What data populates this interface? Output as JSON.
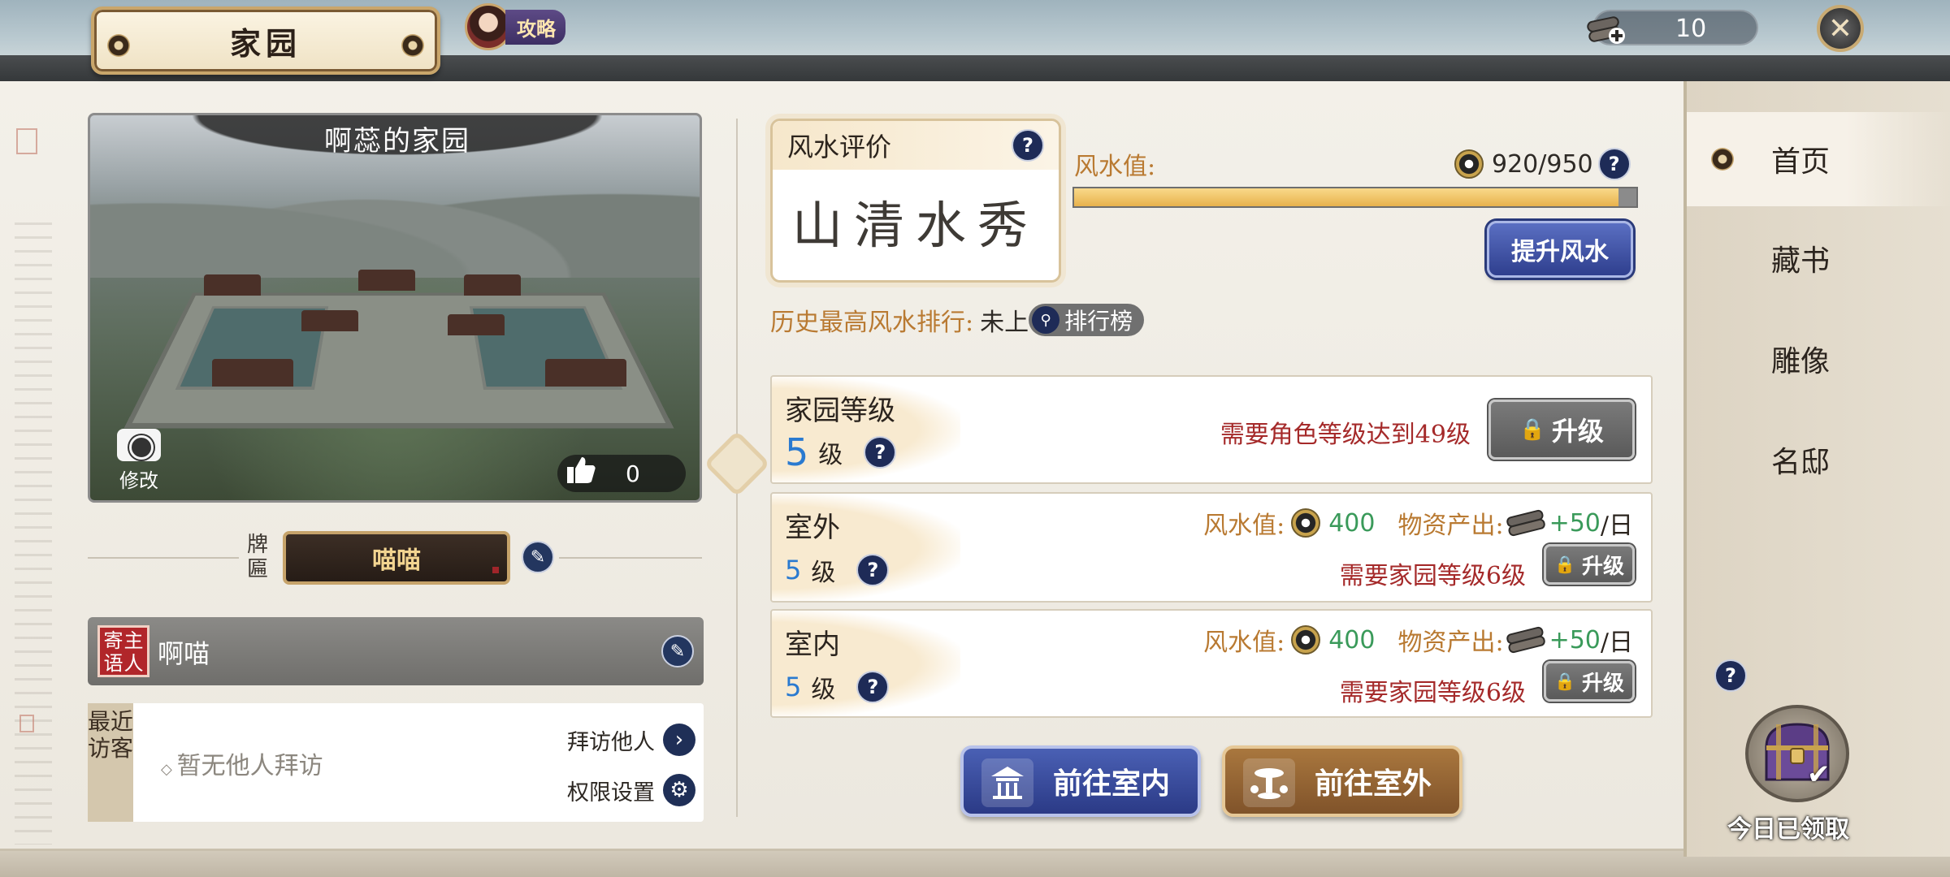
{
  "header": {
    "title": "家园",
    "guide_label": "攻略",
    "resource_value": "10",
    "close_symbol": "✕"
  },
  "home": {
    "name": "啊蕊的家园",
    "photo_edit_label": "修改",
    "likes": "0",
    "plaque_label": "牌匾",
    "plaque_name": "喵喵",
    "host_seal": [
      "寄",
      "主",
      "语",
      "人"
    ],
    "host_message": "啊喵",
    "visitors_label": "最近访客",
    "visitors_empty": "暂无他人拜访",
    "visit_others": "拜访他人",
    "permission_settings": "权限设置"
  },
  "fengshui": {
    "card_title": "风水评价",
    "rating": "山清水秀",
    "value_label": "风水值:",
    "value_text": "920/950",
    "progress": 0.968,
    "improve_button": "提升风水",
    "ranking_label": "历史最高风水排行:",
    "ranking_value": "未上",
    "ranking_button": "排行榜"
  },
  "levels": {
    "home": {
      "name": "家园等级",
      "level": "5",
      "unit": "级",
      "requirement": "需要角色等级达到49级",
      "upgrade": "升级"
    },
    "outdoor": {
      "name": "室外",
      "level": "5",
      "unit": "级",
      "fs_label": "风水值:",
      "fs_value": "400",
      "output_label": "物资产出:",
      "output_value": "+50",
      "output_unit": "/日",
      "requirement": "需要家园等级6级",
      "upgrade": "升级"
    },
    "indoor": {
      "name": "室内",
      "level": "5",
      "unit": "级",
      "fs_label": "风水值:",
      "fs_value": "400",
      "output_label": "物资产出:",
      "output_value": "+50",
      "output_unit": "/日",
      "requirement": "需要家园等级6级",
      "upgrade": "升级"
    }
  },
  "actions": {
    "go_indoor": "前往室内",
    "go_outdoor": "前往室外"
  },
  "nav": {
    "items": [
      "首页",
      "藏书",
      "雕像",
      "名邸"
    ],
    "active_index": 0
  },
  "daily": {
    "caption": "今日已领取"
  },
  "colors": {
    "accent_blue": "#2f3f8e",
    "requirement_red": "#a52a2a",
    "label_gold": "#b97a32",
    "stat_green": "#3a9a5a",
    "bar_fill": "#e8b24c"
  }
}
